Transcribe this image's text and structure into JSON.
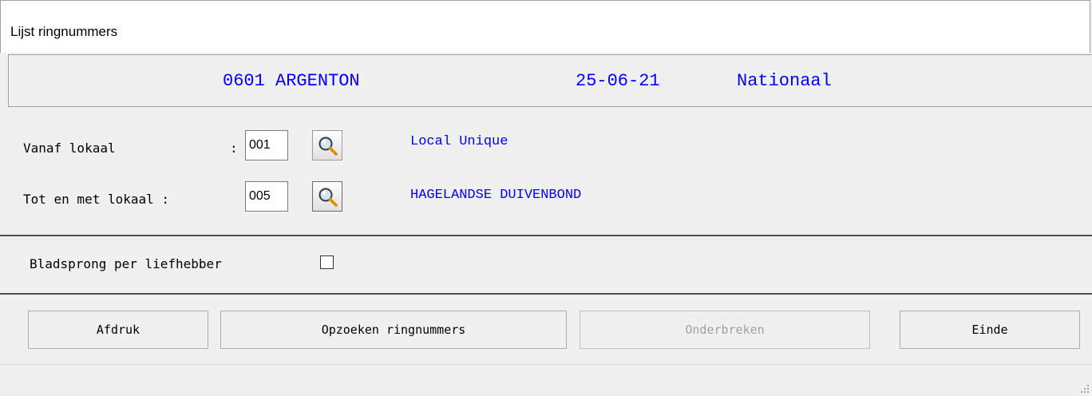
{
  "window": {
    "title": "Lijst ringnummers"
  },
  "header": {
    "race": "0601 ARGENTON",
    "date": "25-06-21",
    "category": "Nationaal"
  },
  "form": {
    "from_label": "Vanaf lokaal",
    "from_colon": ":",
    "from_value": "001",
    "from_name": "Local Unique",
    "to_label": "Tot en met lokaal :",
    "to_value": "005",
    "to_name": "HAGELANDSE DUIVENBOND",
    "pagebreak_label": "Bladsprong per liefhebber",
    "pagebreak_checked": false
  },
  "buttons": {
    "print": "Afdruk",
    "search": "Opzoeken ringnummers",
    "cancel": "Onderbreken",
    "end": "Einde"
  },
  "icons": {
    "lookup": "magnifier-icon"
  },
  "colors": {
    "accent": "#0000ff"
  }
}
